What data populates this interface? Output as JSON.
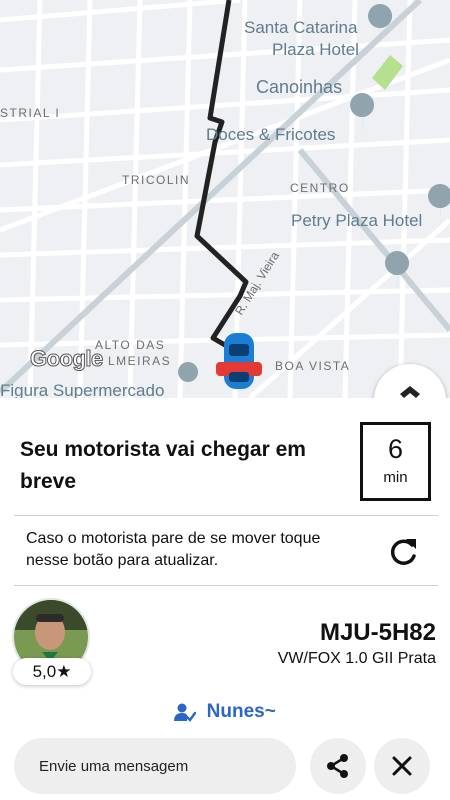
{
  "map": {
    "labels": {
      "santa_catarina_line1": "Santa Catarina",
      "santa_catarina_line2": "Plaza Hotel",
      "canoinhas": "Canoinhas",
      "doces": "Doces & Fricotes",
      "industrial": "STRIAL I",
      "tricolin": "TRICOLIN",
      "centro": "CENTRO",
      "petry": "Petry Plaza Hotel",
      "street": "R. Maj. Vieira",
      "alto_line1": "ALTO DAS",
      "alto_line2": "LMEIRAS",
      "boa_vista": "BOA VISTA",
      "supermercado": "Figura Supermercado"
    },
    "google_logo": "Google",
    "icons": {
      "hotel": "hotel-pin-icon",
      "restaurant": "restaurant-pin-icon",
      "hospital": "hospital-pin-icon",
      "car": "car-icon",
      "compass": "compass-icon"
    }
  },
  "trip": {
    "arrival_message": "Seu motorista vai chegar em breve",
    "eta_value": "6",
    "eta_unit": "min",
    "refresh_hint": "Caso o motorista pare de se mover toque nesse botão para atualizar."
  },
  "driver": {
    "rating": "5,0★",
    "plate": "MJU-5H82",
    "car_model": "VW/FOX 1.0 GII Prata",
    "name": "Nunes~"
  },
  "actions": {
    "message_placeholder": "Envie uma mensagem",
    "share_icon": "share-icon",
    "close_icon": "close-icon"
  },
  "colors": {
    "accent": "#2c66c8",
    "route": "#222222",
    "map_bg": "#eef0f3",
    "park": "#b5e08e"
  }
}
